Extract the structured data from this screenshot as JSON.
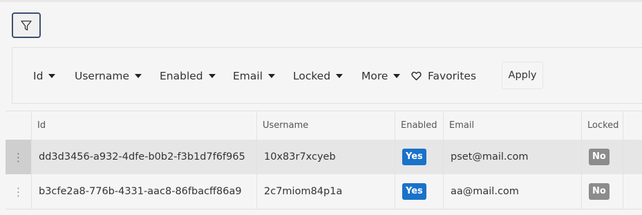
{
  "filter_bar": {
    "items": [
      {
        "label": "Id"
      },
      {
        "label": "Username"
      },
      {
        "label": "Enabled"
      },
      {
        "label": "Email"
      },
      {
        "label": "Locked"
      },
      {
        "label": "More"
      }
    ],
    "favorites_label": "Favorites",
    "apply_label": "Apply"
  },
  "table": {
    "columns": [
      "Id",
      "Username",
      "Enabled",
      "Email",
      "Locked"
    ],
    "rows": [
      {
        "id": "dd3d3456-a932-4dfe-b0b2-f3b1d7f6f965",
        "username": "10x83r7xcyeb",
        "enabled": "Yes",
        "email": "pset@mail.com",
        "locked": "No",
        "selected": true
      },
      {
        "id": "b3cfe2a8-776b-4331-aac8-86fbacff86a9",
        "username": "2c7miom84p1a",
        "enabled": "Yes",
        "email": "aa@mail.com",
        "locked": "No",
        "selected": false
      }
    ],
    "row_handle": "⋮"
  },
  "colors": {
    "enabled_badge": "#1a72c9",
    "locked_badge": "#8c8c8c",
    "toggle_border": "#3d4f6e"
  },
  "icons": {
    "filter_toggle": "filter-funnel-icon",
    "favorites": "heart-outline-icon",
    "dropdown": "caret-down-icon",
    "row_menu": "vertical-dots-icon"
  }
}
